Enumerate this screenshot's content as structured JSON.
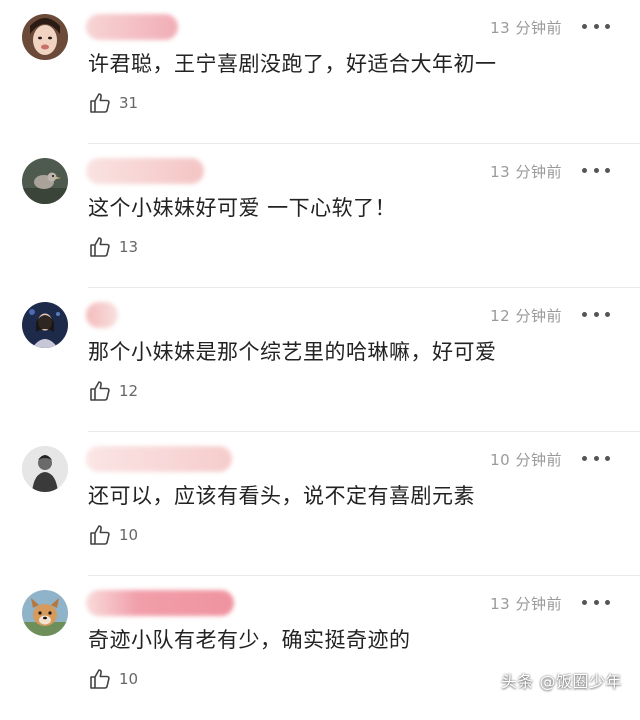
{
  "colors": {
    "background": "#ffffff",
    "time_text": "#9a9a9a",
    "name_redaction": "#f6c6c6",
    "name_redaction_strong": "#f29aa6",
    "divider": "#eaeaea"
  },
  "comments": [
    {
      "time": "13 分钟前",
      "text": "许君聪，王宁喜剧没跑了，好适合大年初一",
      "likes": "31",
      "avatar_icon": "avatar-woman-photo"
    },
    {
      "time": "13 分钟前",
      "text": "这个小妹妹好可爱 一下心软了！",
      "likes": "13",
      "avatar_icon": "avatar-bird-photo"
    },
    {
      "time": "12 分钟前",
      "text": "那个小妹妹是那个综艺里的哈琳嘛，好可爱",
      "likes": "12",
      "avatar_icon": "avatar-singer-photo"
    },
    {
      "time": "10 分钟前",
      "text": "还可以，应该有看头，说不定有喜剧元素",
      "likes": "10",
      "avatar_icon": "avatar-bw-person-photo"
    },
    {
      "time": "13 分钟前",
      "text": "奇迹小队有老有少，确实挺奇迹的",
      "likes": "10",
      "avatar_icon": "avatar-dog-photo"
    }
  ],
  "watermark": "头条 @饭圈少年"
}
